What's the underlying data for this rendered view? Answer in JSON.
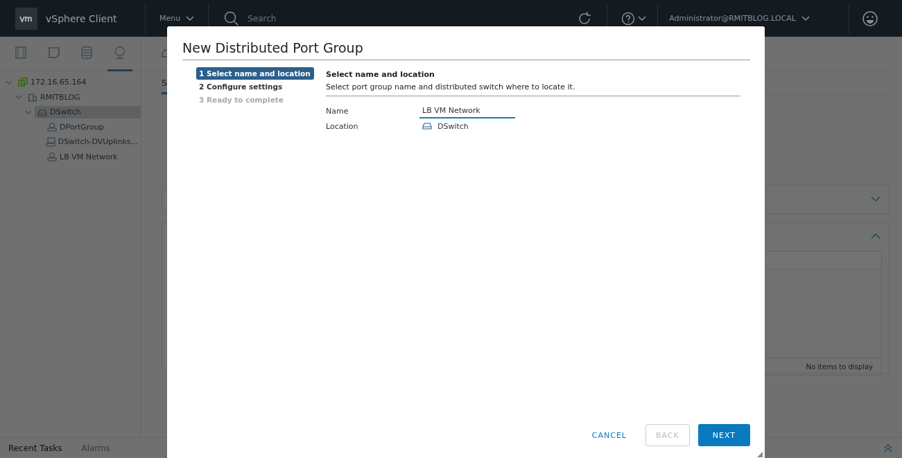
{
  "header": {
    "product": "vSphere Client",
    "menu": "Menu",
    "search": {
      "placeholder": "Search"
    },
    "user": "Administrator@RMITBLOG.LOCAL"
  },
  "sidebar": {
    "tabs": [
      {
        "kind": "hosts",
        "selected": false
      },
      {
        "kind": "vms",
        "selected": false
      },
      {
        "kind": "storage",
        "selected": false
      },
      {
        "kind": "network",
        "selected": true
      }
    ],
    "tree": [
      {
        "label": "172.16.65.164",
        "kind": "vcenter",
        "expanded": true,
        "selected": false,
        "children": [
          {
            "label": "RMITBLOG",
            "kind": "datacenter",
            "expanded": true,
            "selected": false,
            "children": [
              {
                "label": "DSwitch",
                "kind": "switch",
                "expanded": true,
                "selected": true,
                "children": [
                  {
                    "label": "DPortGroup",
                    "kind": "portgroup",
                    "selected": false
                  },
                  {
                    "label": "DSwitch-DVUplinks...",
                    "kind": "uplink",
                    "selected": false
                  },
                  {
                    "label": "LB VM Network",
                    "kind": "portgroup",
                    "selected": false
                  }
                ]
              }
            ]
          }
        ]
      }
    ]
  },
  "main": {
    "tab": "S",
    "table_footer": "No items to display"
  },
  "bottom_bar": {
    "tabs": [
      {
        "label": "Recent Tasks",
        "selected": true
      },
      {
        "label": "Alarms",
        "selected": false
      }
    ]
  },
  "dialog": {
    "title": "New Distributed Port Group",
    "steps": [
      {
        "label": "1 Select name and location",
        "selected": true,
        "disabled": false
      },
      {
        "label": "2 Configure settings",
        "selected": false,
        "disabled": false
      },
      {
        "label": "3 Ready to complete",
        "selected": false,
        "disabled": true
      }
    ],
    "section_title": "Select name and location",
    "section_subtitle": "Select port group name and distributed switch where to locate it.",
    "fields": [
      {
        "label": "Name",
        "kind": "input",
        "value": "LB VM Network"
      },
      {
        "label": "Location",
        "kind": "switch",
        "value": "DSwitch"
      }
    ],
    "buttons": [
      {
        "label": "CANCEL",
        "kind": "link",
        "disabled": false
      },
      {
        "label": "BACK",
        "kind": "outline",
        "disabled": true
      },
      {
        "label": "NEXT",
        "kind": "primary",
        "disabled": false
      }
    ]
  }
}
